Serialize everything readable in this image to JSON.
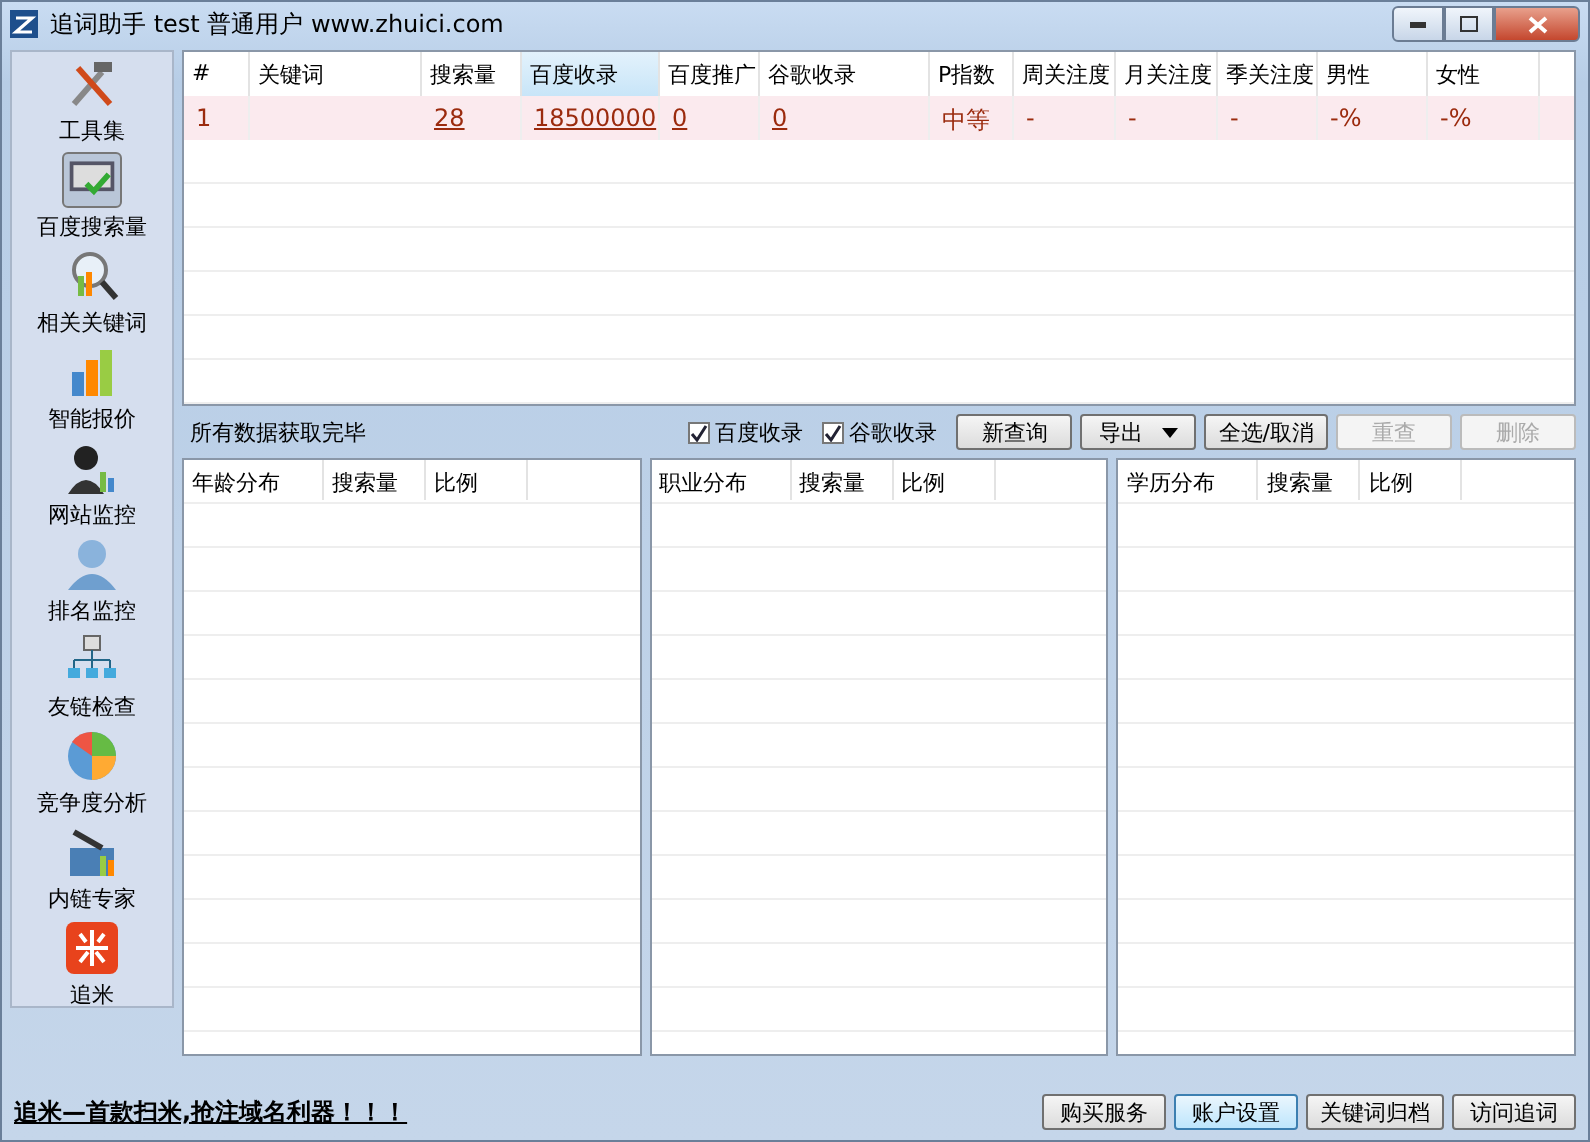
{
  "window": {
    "title": "追词助手 test 普通用户 www.zhuici.com"
  },
  "sidebar": {
    "items": [
      {
        "label": "工具集",
        "selected": false
      },
      {
        "label": "百度搜索量",
        "selected": true
      },
      {
        "label": "相关关键词",
        "selected": false
      },
      {
        "label": "智能报价",
        "selected": false
      },
      {
        "label": "网站监控",
        "selected": false
      },
      {
        "label": "排名监控",
        "selected": false
      },
      {
        "label": "友链检查",
        "selected": false
      },
      {
        "label": "竞争度分析",
        "selected": false
      },
      {
        "label": "内链专家",
        "selected": false
      },
      {
        "label": "追米",
        "selected": false
      }
    ]
  },
  "table": {
    "columns": [
      {
        "label": "#",
        "selected": false
      },
      {
        "label": "关键词",
        "selected": false
      },
      {
        "label": "搜索量",
        "selected": false
      },
      {
        "label": "百度收录",
        "selected": true
      },
      {
        "label": "百度推广",
        "selected": false
      },
      {
        "label": "谷歌收录",
        "selected": false
      },
      {
        "label": "P指数",
        "selected": false
      },
      {
        "label": "周关注度",
        "selected": false
      },
      {
        "label": "月关注度",
        "selected": false
      },
      {
        "label": "季关注度",
        "selected": false
      },
      {
        "label": "男性",
        "selected": false
      },
      {
        "label": "女性",
        "selected": false
      }
    ],
    "rows": [
      {
        "selected": true,
        "cells": [
          {
            "text": "1",
            "link": false
          },
          null,
          {
            "text": "28",
            "link": true
          },
          {
            "text": "18500000",
            "link": true
          },
          {
            "text": "0",
            "link": true
          },
          {
            "text": "0",
            "link": true
          },
          {
            "text": "中等",
            "link": false
          },
          {
            "text": "-",
            "link": false
          },
          {
            "text": "-",
            "link": false
          },
          {
            "text": "-",
            "link": false
          },
          {
            "text": "-%",
            "link": false
          },
          {
            "text": "-%",
            "link": false
          }
        ]
      }
    ]
  },
  "toolbar": {
    "status": "所有数据获取完毕",
    "checks": [
      {
        "label": "百度收录",
        "checked": true
      },
      {
        "label": "谷歌收录",
        "checked": true
      }
    ],
    "buttons": [
      {
        "label": "新查询",
        "kind": "plain",
        "disabled": false
      },
      {
        "label": "导出",
        "kind": "dropdown",
        "disabled": false
      },
      {
        "label": "全选/取消",
        "kind": "plain",
        "disabled": false
      },
      {
        "label": "重查",
        "kind": "plain",
        "disabled": true
      },
      {
        "label": "删除",
        "kind": "plain",
        "disabled": true
      }
    ]
  },
  "panels": [
    {
      "columns": [
        "年龄分布",
        "搜索量",
        "比例"
      ]
    },
    {
      "columns": [
        "职业分布",
        "搜索量",
        "比例"
      ]
    },
    {
      "columns": [
        "学历分布",
        "搜索量",
        "比例"
      ]
    }
  ],
  "footer": {
    "slogan": "追米—首款扫米,抢注域名利器！！！",
    "buttons": [
      {
        "label": "购买服务",
        "selected": false
      },
      {
        "label": "账户设置",
        "selected": true
      },
      {
        "label": "关键词归档",
        "selected": false
      },
      {
        "label": "访问追词",
        "selected": false
      }
    ]
  }
}
